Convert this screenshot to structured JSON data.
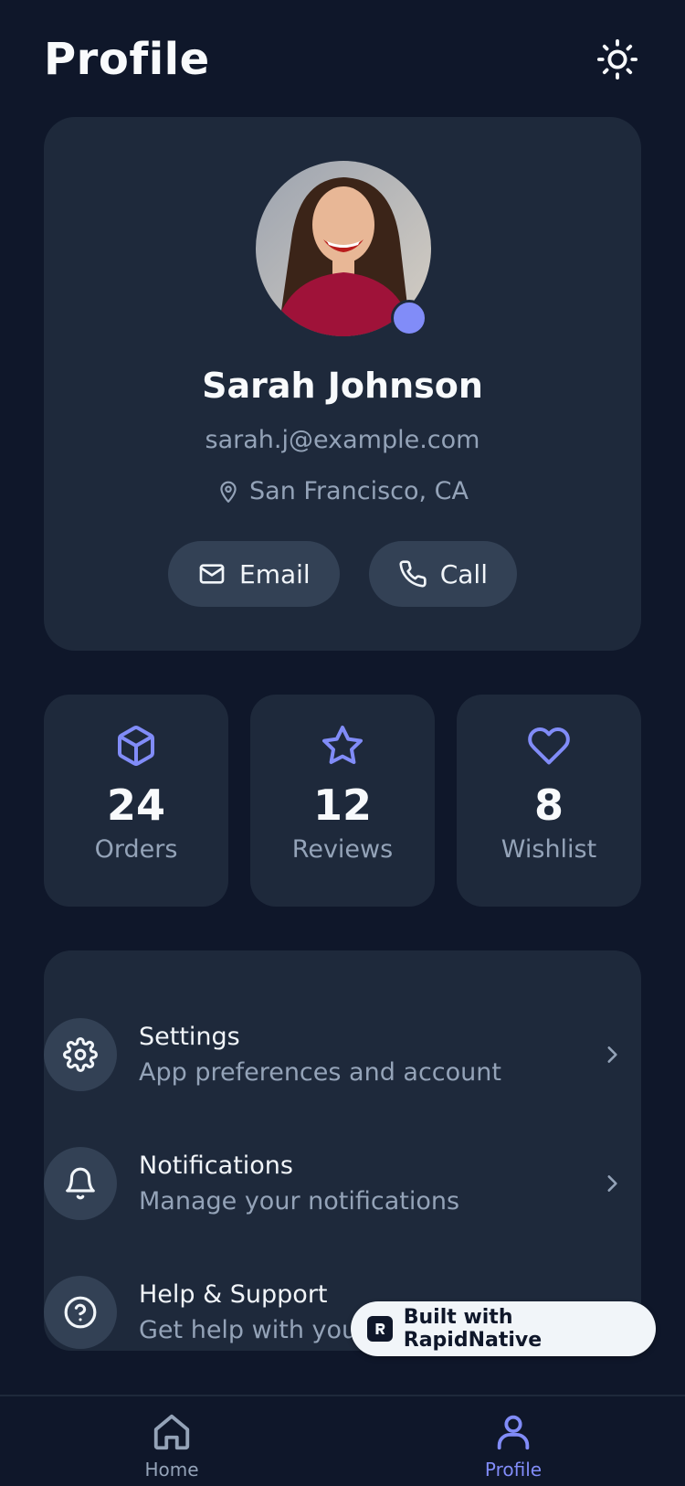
{
  "header": {
    "title": "Profile",
    "theme_icon": "sun-icon"
  },
  "profile": {
    "name": "Sarah Johnson",
    "email": "sarah.j@example.com",
    "location": "San Francisco, CA",
    "status_color": "#818cf8",
    "actions": [
      {
        "label": "Email",
        "icon": "mail-icon"
      },
      {
        "label": "Call",
        "icon": "phone-icon"
      }
    ]
  },
  "stats": [
    {
      "value": "24",
      "label": "Orders",
      "icon": "package-icon"
    },
    {
      "value": "12",
      "label": "Reviews",
      "icon": "star-icon"
    },
    {
      "value": "8",
      "label": "Wishlist",
      "icon": "heart-icon"
    }
  ],
  "menu": [
    {
      "title": "Settings",
      "subtitle": "App preferences and account",
      "icon": "gear-icon"
    },
    {
      "title": "Notifications",
      "subtitle": "Manage your notifications",
      "icon": "bell-icon"
    },
    {
      "title": "Help & Support",
      "subtitle": "Get help with your account",
      "icon": "help-icon"
    }
  ],
  "badge": {
    "label": "Built with RapidNative"
  },
  "tabbar": {
    "items": [
      {
        "label": "Home",
        "icon": "home-icon",
        "active": false
      },
      {
        "label": "Profile",
        "icon": "user-icon",
        "active": true
      }
    ]
  },
  "colors": {
    "accent": "#818cf8",
    "background": "#0f172a",
    "card": "#1e293b",
    "muted": "#94a3b8"
  }
}
